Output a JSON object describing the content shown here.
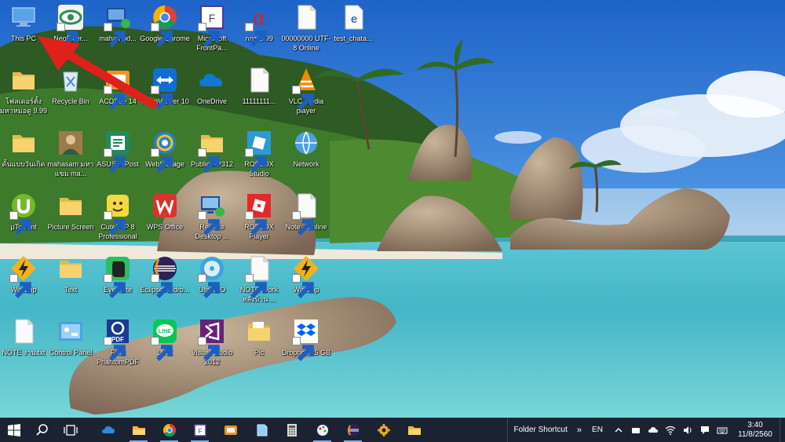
{
  "desktop": {
    "icons": [
      {
        "label": "This PC",
        "icon": "this-pc-icon",
        "shortcut": false
      },
      {
        "label": "NeoFilter...",
        "icon": "eye-icon",
        "shortcut": true
      },
      {
        "label": "mahamod...",
        "icon": "remote-icon",
        "shortcut": true
      },
      {
        "label": "Google Chrome",
        "icon": "chrome-icon",
        "shortcut": true
      },
      {
        "label": "Microsoft FrontPa...",
        "icon": "frontpage-icon",
        "shortcut": true
      },
      {
        "label": "กกร 9.99",
        "icon": "alpha-icon",
        "shortcut": true
      },
      {
        "label": "00000000 UTF-8 Online",
        "icon": "document-icon",
        "shortcut": false
      },
      {
        "label": "test_chata...",
        "icon": "edge-icon",
        "shortcut": false
      },
      {
        "label": "โฟลเดอร์ตั้ง มหาหมอดู 9.99",
        "icon": "folder-icon",
        "shortcut": false
      },
      {
        "label": "Recycle Bin",
        "icon": "recycle-bin-icon",
        "shortcut": false
      },
      {
        "label": "ACDSee 14",
        "icon": "acdsee-icon",
        "shortcut": true
      },
      {
        "label": "TeamViewer 10",
        "icon": "teamviewer-icon",
        "shortcut": true
      },
      {
        "label": "OneDrive",
        "icon": "onedrive-icon",
        "shortcut": false
      },
      {
        "label": "11111111...",
        "icon": "document-icon",
        "shortcut": false
      },
      {
        "label": "VLC media player",
        "icon": "vlc-icon",
        "shortcut": true
      },
      {
        "label": "ดั้นแบบวันเกิด",
        "icon": "folder-icon",
        "shortcut": false
      },
      {
        "label": "mahasam มหาแขม ma...",
        "icon": "person-icon",
        "shortcut": false
      },
      {
        "label": "ASUS HiPost",
        "icon": "hipost-icon",
        "shortcut": true
      },
      {
        "label": "WebStorage",
        "icon": "webstorage-icon",
        "shortcut": true
      },
      {
        "label": "Public XP312",
        "icon": "folder-icon",
        "shortcut": true
      },
      {
        "label": "ROBLOX Studio",
        "icon": "roblox-studio-icon",
        "shortcut": true
      },
      {
        "label": "Network",
        "icon": "network-icon",
        "shortcut": false
      },
      {
        "label": "µTorrent",
        "icon": "utorrent-icon",
        "shortcut": true
      },
      {
        "label": "Picture Screen",
        "icon": "folder-icon",
        "shortcut": false
      },
      {
        "label": "CuteFTP 8 Professional",
        "icon": "cuteftp-icon",
        "shortcut": true
      },
      {
        "label": "WPS Office",
        "icon": "wps-icon",
        "shortcut": false
      },
      {
        "label": "Remote Desktop ...",
        "icon": "remote-desktop-icon",
        "shortcut": true
      },
      {
        "label": "ROBLOX Player",
        "icon": "roblox-player-icon",
        "shortcut": true
      },
      {
        "label": "Note - Online",
        "icon": "document-icon",
        "shortcut": true
      },
      {
        "label": "Winamp",
        "icon": "winamp-icon",
        "shortcut": true
      },
      {
        "label": "Text",
        "icon": "folder-icon",
        "shortcut": false
      },
      {
        "label": "Evernote",
        "icon": "evernote-icon",
        "shortcut": true
      },
      {
        "label": "Eclipse Andro...",
        "icon": "eclipse-icon",
        "shortcut": true
      },
      {
        "label": "UltraISO",
        "icon": "ultraiso-icon",
        "shortcut": true
      },
      {
        "label": "NOTE Work หลังบ้าน ...",
        "icon": "document-icon",
        "shortcut": true
      },
      {
        "label": "Winamp",
        "icon": "winamp-icon",
        "shortcut": true
      },
      {
        "label": "NOTE งาน.txt",
        "icon": "document-icon",
        "shortcut": false
      },
      {
        "label": "Control Panel",
        "icon": "control-panel-icon",
        "shortcut": false
      },
      {
        "label": "Foxit PhantomPDF",
        "icon": "foxit-icon",
        "shortcut": true
      },
      {
        "label": "LINE",
        "icon": "line-icon",
        "shortcut": true
      },
      {
        "label": "Visual Studio 2012",
        "icon": "visual-studio-icon",
        "shortcut": true
      },
      {
        "label": "Pic",
        "icon": "folder-doc-icon",
        "shortcut": false
      },
      {
        "label": "Dropbox 25 GB",
        "icon": "dropbox-icon",
        "shortcut": true
      }
    ]
  },
  "taskbar": {
    "folder_shortcut_label": "Folder Shortcut",
    "chevron": "»",
    "lang": "EN",
    "time": "3:40",
    "date": "11/8/2560",
    "apps": [
      "onedrive-icon",
      "file-explorer-icon",
      "chrome-icon",
      "frontpage-icon",
      "photos-icon",
      "edge-beta-icon",
      "calculator-icon",
      "paint-icon",
      "eclipse-icon",
      "settings-icon",
      "folder-icon"
    ]
  }
}
